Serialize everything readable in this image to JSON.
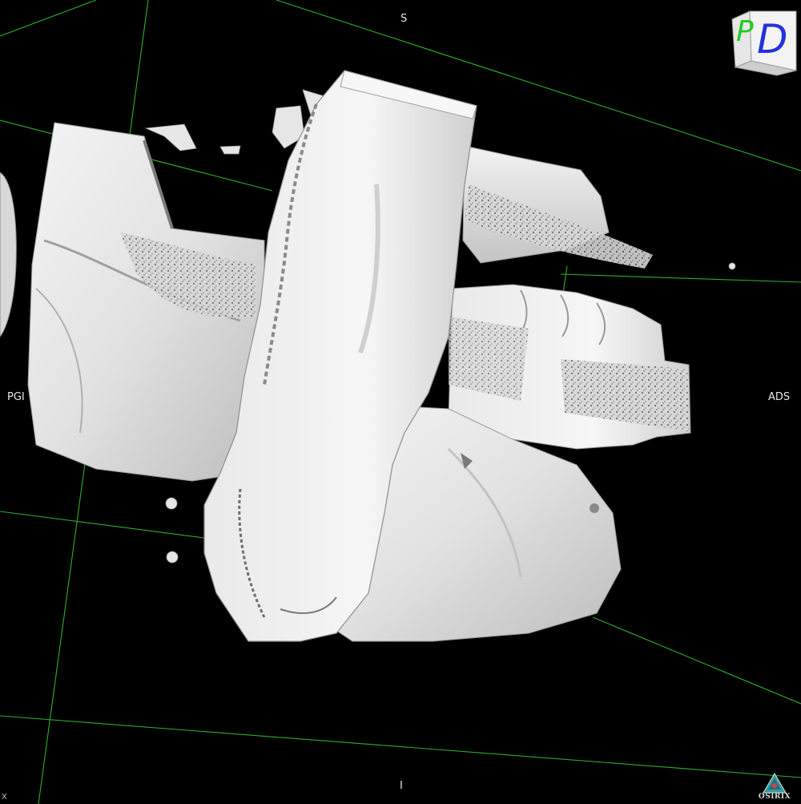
{
  "orientation": {
    "top": "S",
    "bottom": "I",
    "left": "PGI",
    "right": "ADS",
    "corner": "X"
  },
  "orientation_cube": {
    "left_face": "P",
    "front_face": "D",
    "left_color": "#22cc22",
    "front_color": "#2233dd"
  },
  "branding": {
    "logo_text": "OSIRIX"
  },
  "colors": {
    "background": "#000000",
    "bounding_box": "#2fae2f",
    "surface": "#e6e6e6"
  }
}
